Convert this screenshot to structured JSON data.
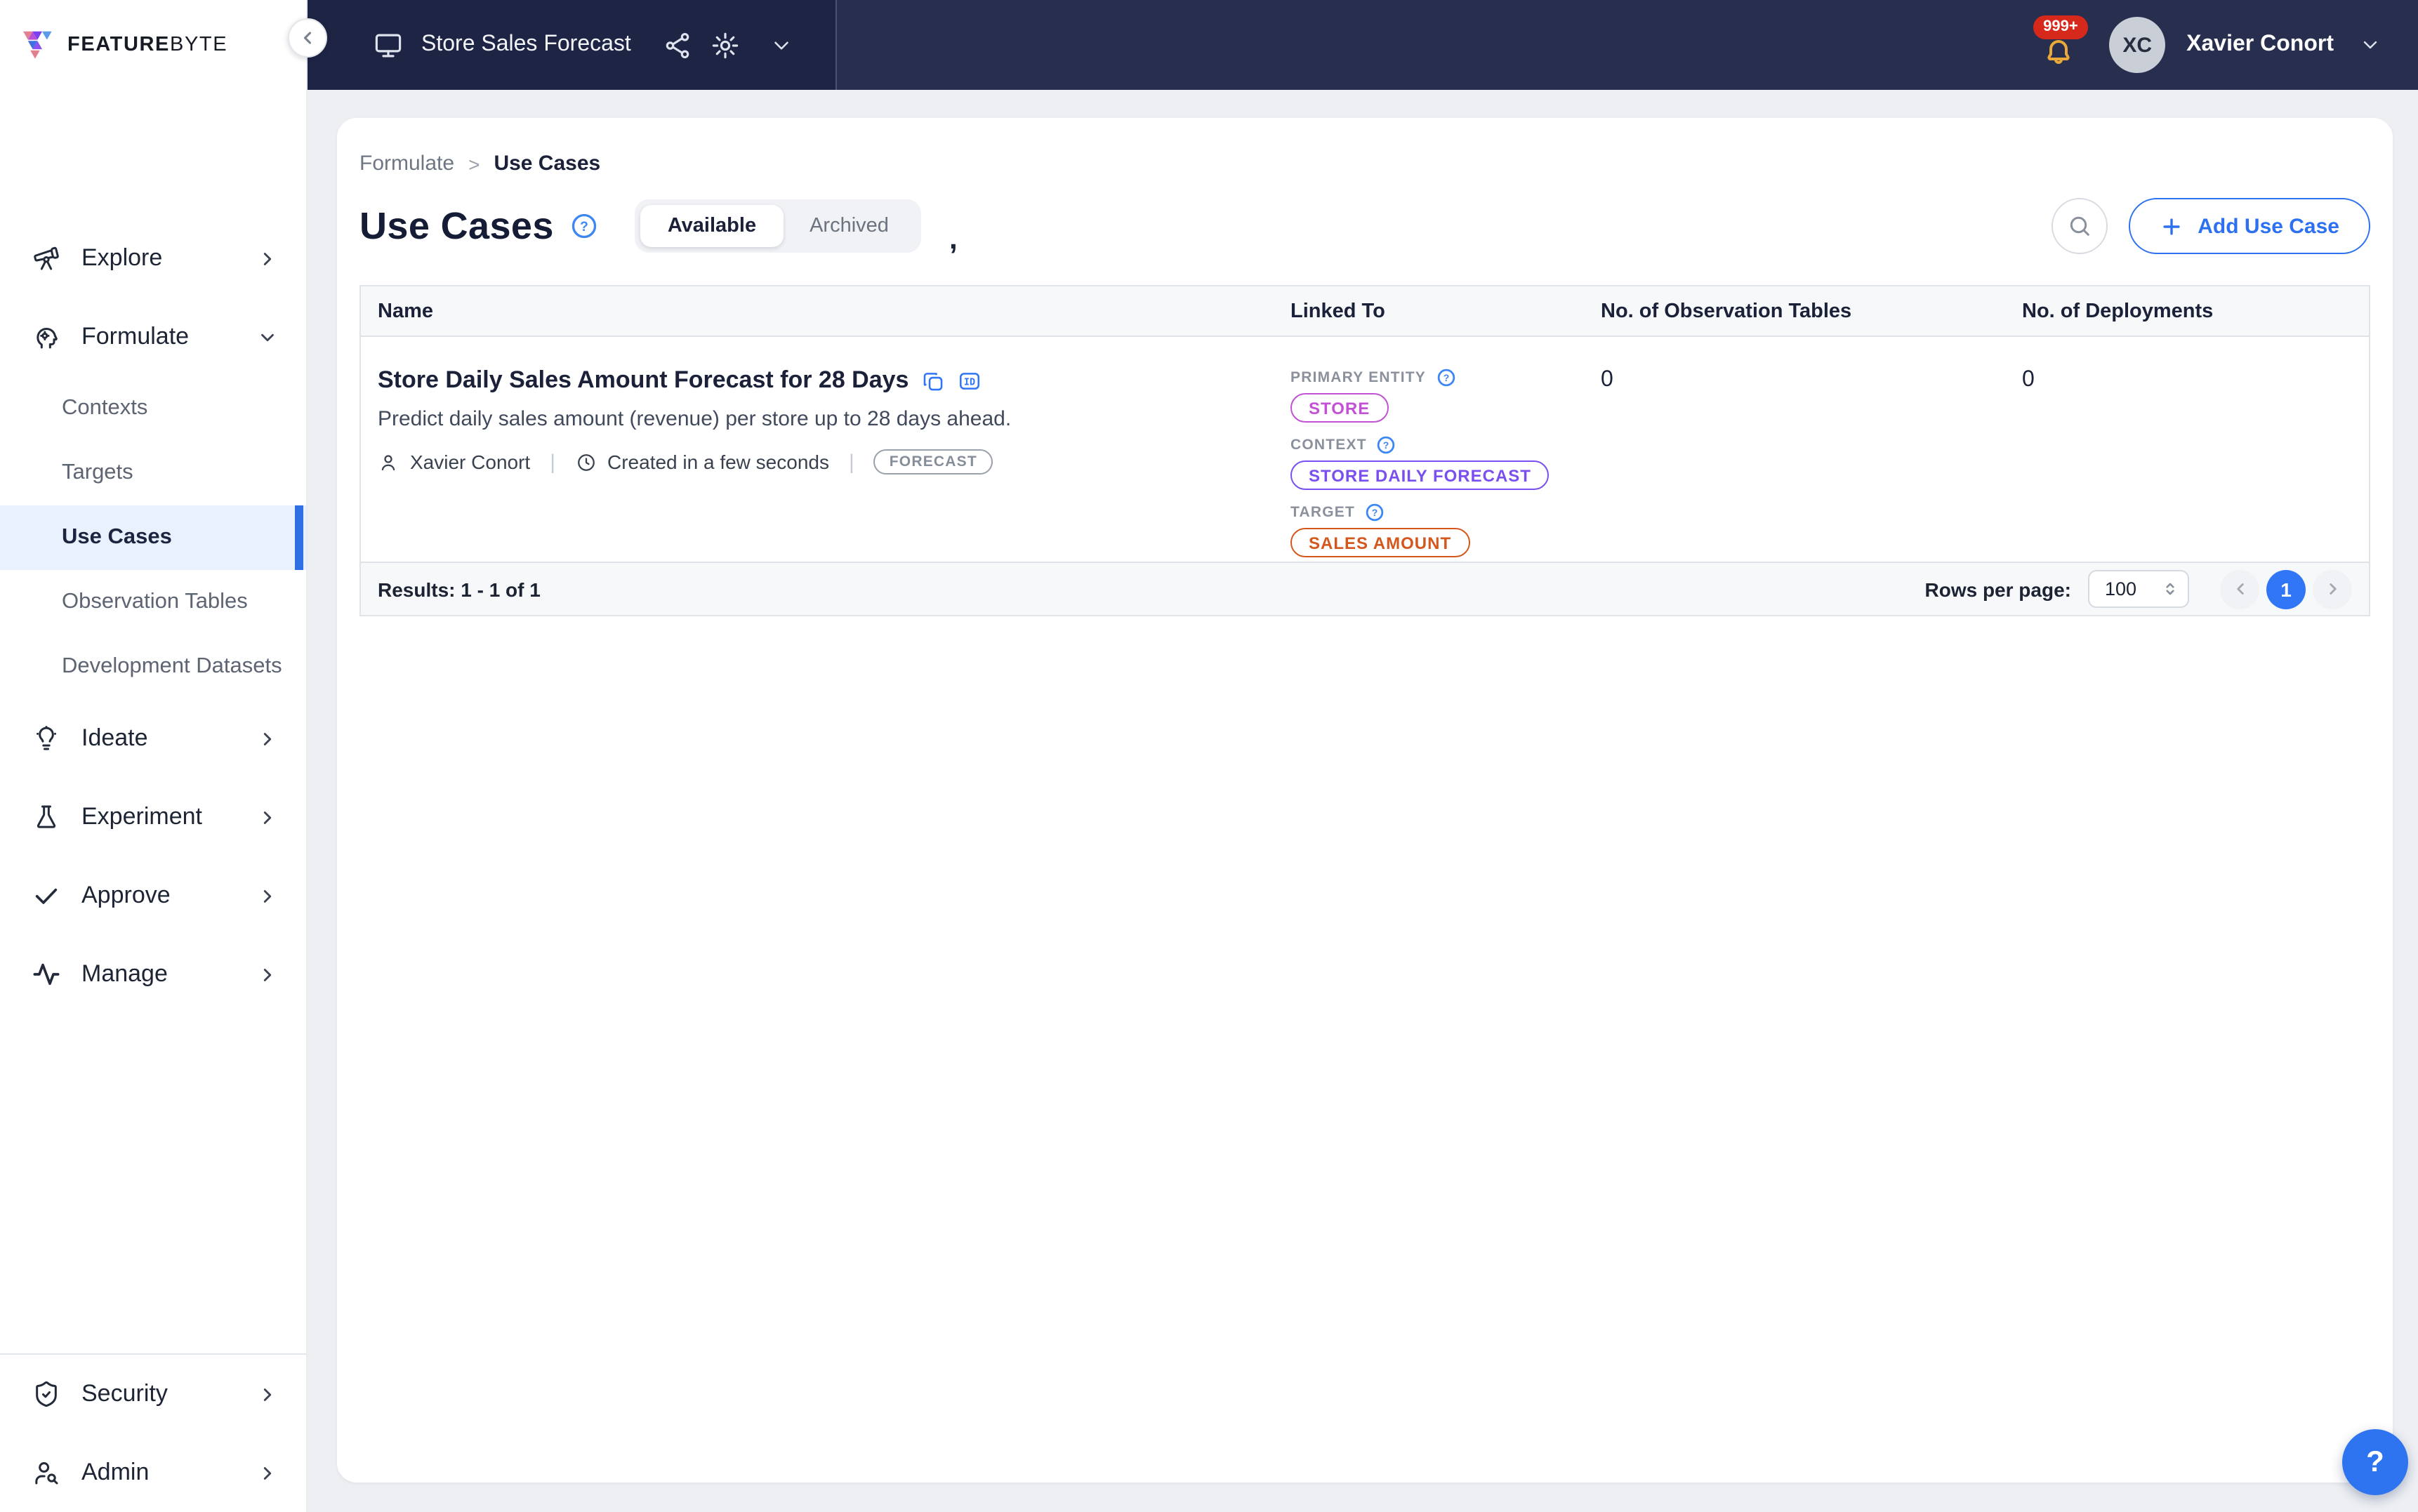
{
  "brand": {
    "logo_text_bold": "FEATURE",
    "logo_text_light": "BYTE"
  },
  "header": {
    "project_title": "Store Sales Forecast",
    "notifications_badge": "999+",
    "user_initials": "XC",
    "user_name": "Xavier Conort"
  },
  "sidebar": {
    "items": [
      {
        "label": "Explore"
      },
      {
        "label": "Formulate"
      },
      {
        "label": "Contexts"
      },
      {
        "label": "Targets"
      },
      {
        "label": "Use Cases"
      },
      {
        "label": "Observation Tables"
      },
      {
        "label": "Development Datasets"
      },
      {
        "label": "Ideate"
      },
      {
        "label": "Experiment"
      },
      {
        "label": "Approve"
      },
      {
        "label": "Manage"
      },
      {
        "label": "Security"
      },
      {
        "label": "Admin"
      }
    ]
  },
  "breadcrumb": {
    "parent": "Formulate",
    "separator": ">",
    "current": "Use Cases"
  },
  "toolbar": {
    "title": "Use Cases",
    "tabs": [
      "Available",
      "Archived"
    ],
    "stray_text": ",",
    "add_button_label": "Add Use Case"
  },
  "table": {
    "columns": [
      "Name",
      "Linked To",
      "No. of Observation Tables",
      "No. of Deployments"
    ],
    "row": {
      "name": "Store Daily Sales Amount Forecast for 28 Days",
      "description": "Predict daily sales amount (revenue) per store up to 28 days ahead.",
      "author": "Xavier Conort",
      "created": "Created in a few seconds",
      "type_badge": "FORECAST",
      "linked": [
        {
          "label": "PRIMARY ENTITY",
          "value": "STORE",
          "color": "#c351d6"
        },
        {
          "label": "CONTEXT",
          "value": "STORE DAILY FORECAST",
          "color": "#7a4ff0"
        },
        {
          "label": "TARGET",
          "value": "SALES AMOUNT",
          "color": "#d4571e"
        }
      ],
      "observation_tables": "0",
      "deployments": "0"
    },
    "footer": {
      "results": "Results: 1 - 1 of 1",
      "rows_per_page_label": "Rows per page:",
      "rows_per_page_value": "100",
      "page_number": "1"
    }
  },
  "help": {
    "button_label": "?"
  },
  "colors": {
    "accent_blue": "#2d71f0",
    "header_navy": "#272e4e",
    "project_navy": "#1e2443",
    "active_item_blue": "#2f6fe4",
    "store_pill": "#c351d6",
    "context_pill": "#7a4ff0",
    "target_pill": "#d4571e",
    "badge_red": "#d7281c",
    "bell_amber": "#eaa938"
  }
}
